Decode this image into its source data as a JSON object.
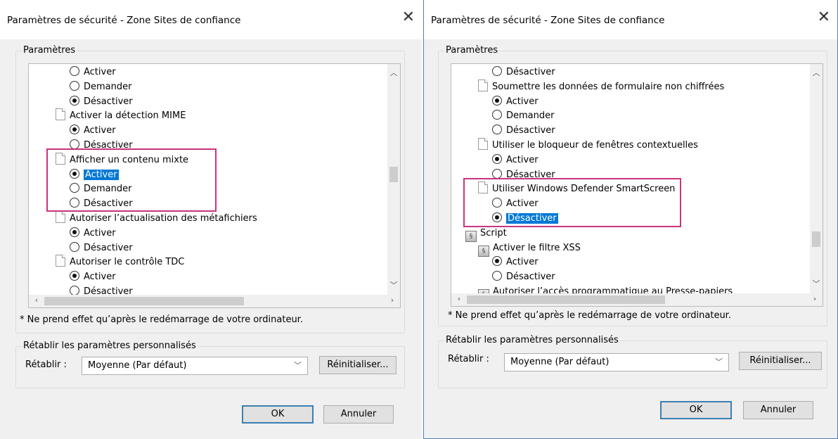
{
  "left": {
    "title": "Paramètres de sécurité - Zone Sites de confiance",
    "group_label": "Paramètres",
    "items": [
      {
        "kind": "radio",
        "text": "Activer",
        "checked": false
      },
      {
        "kind": "radio",
        "text": "Demander",
        "checked": false
      },
      {
        "kind": "radio",
        "text": "Désactiver",
        "checked": true
      },
      {
        "kind": "doc",
        "text": "Activer la détection MIME"
      },
      {
        "kind": "radio",
        "text": "Activer",
        "checked": true
      },
      {
        "kind": "radio",
        "text": "Désactiver",
        "checked": false
      },
      {
        "kind": "doc",
        "text": "Afficher un contenu mixte"
      },
      {
        "kind": "radio",
        "text": "Activer",
        "checked": true,
        "selected": true
      },
      {
        "kind": "radio",
        "text": "Demander",
        "checked": false
      },
      {
        "kind": "radio",
        "text": "Désactiver",
        "checked": false
      },
      {
        "kind": "doc",
        "text": "Autoriser l’actualisation des métafichiers"
      },
      {
        "kind": "radio",
        "text": "Activer",
        "checked": true
      },
      {
        "kind": "radio",
        "text": "Désactiver",
        "checked": false
      },
      {
        "kind": "doc",
        "text": "Autoriser le contrôle TDC"
      },
      {
        "kind": "radio",
        "text": "Activer",
        "checked": true
      },
      {
        "kind": "radio",
        "text": "Désactiver",
        "checked": false
      }
    ],
    "note": "* Ne prend effet qu’après le redémarrage de votre ordinateur.",
    "reset_group_label": "Rétablir les paramètres personnalisés",
    "reset_label": "Rétablir :",
    "reset_value": "Moyenne (Par défaut)",
    "reset_button": "Réinitialiser...",
    "ok": "OK",
    "cancel": "Annuler"
  },
  "right": {
    "title": "Paramètres de sécurité - Zone Sites de confiance",
    "group_label": "Paramètres",
    "items": [
      {
        "kind": "radio",
        "text": "Désactiver",
        "checked": false
      },
      {
        "kind": "doc",
        "text": "Soumettre les données de formulaire non chiffrées"
      },
      {
        "kind": "radio",
        "text": "Activer",
        "checked": true
      },
      {
        "kind": "radio",
        "text": "Demander",
        "checked": false
      },
      {
        "kind": "radio",
        "text": "Désactiver",
        "checked": false
      },
      {
        "kind": "doc",
        "text": "Utiliser le bloqueur de fenêtres contextuelles"
      },
      {
        "kind": "radio",
        "text": "Activer",
        "checked": true
      },
      {
        "kind": "radio",
        "text": "Désactiver",
        "checked": false
      },
      {
        "kind": "doc",
        "text": "Utiliser Windows Defender SmartScreen"
      },
      {
        "kind": "radio",
        "text": "Activer",
        "checked": false
      },
      {
        "kind": "radio",
        "text": "Désactiver",
        "checked": true,
        "selected": true
      },
      {
        "kind": "script",
        "text": "Script"
      },
      {
        "kind": "script",
        "text": "Activer le filtre XSS",
        "indent": 1
      },
      {
        "kind": "radio",
        "text": "Activer",
        "checked": true
      },
      {
        "kind": "radio",
        "text": "Désactiver",
        "checked": false
      },
      {
        "kind": "script",
        "text": "Autoriser l’accès programmatique au Presse-papiers",
        "indent": 1
      }
    ],
    "note": "* Ne prend effet qu’après le redémarrage de votre ordinateur.",
    "reset_group_label": "Rétablir les paramètres personnalisés",
    "reset_label": "Rétablir :",
    "reset_value": "Moyenne (Par défaut)",
    "reset_button": "Réinitialiser...",
    "ok": "OK",
    "cancel": "Annuler"
  },
  "icons": {
    "close": "close-icon",
    "radio": "radio-icon",
    "doc": "document-icon",
    "script": "script-icon",
    "chevron": "chevron-down-icon"
  }
}
